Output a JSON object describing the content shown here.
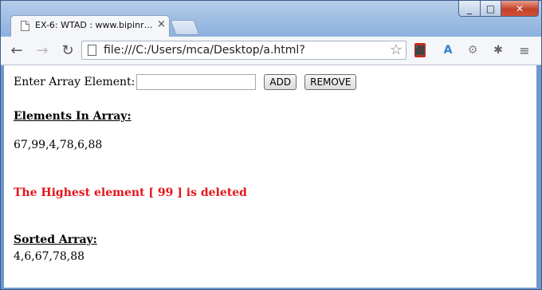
{
  "browser": {
    "tab_title": "EX-6: WTAD : www.bipinr…",
    "tab_close": "×",
    "url": "file:///C:/Users/mca/Desktop/a.html?",
    "icons": [
      "back-icon",
      "forward-icon",
      "reload-icon",
      "page-icon",
      "star-icon",
      "acrobat-icon",
      "translate-icon",
      "gear-icon",
      "bug-icon",
      "menu-icon"
    ],
    "window_controls": {
      "minimize": "_",
      "maximize": "□",
      "close": "✕"
    }
  },
  "form": {
    "label": "Enter Array Element:",
    "input_value": "",
    "add_label": "ADD",
    "remove_label": "REMOVE"
  },
  "elements_heading": "Elements In Array:",
  "elements_value": "67,99,4,78,6,88",
  "deleted_message": "The Highest element [ 99 ] is deleted",
  "sorted_heading": "Sorted Array:",
  "sorted_value": "4,6,67,78,88",
  "colors": {
    "message_red": "#e3161b",
    "titlebar": "#9cbbe2"
  }
}
